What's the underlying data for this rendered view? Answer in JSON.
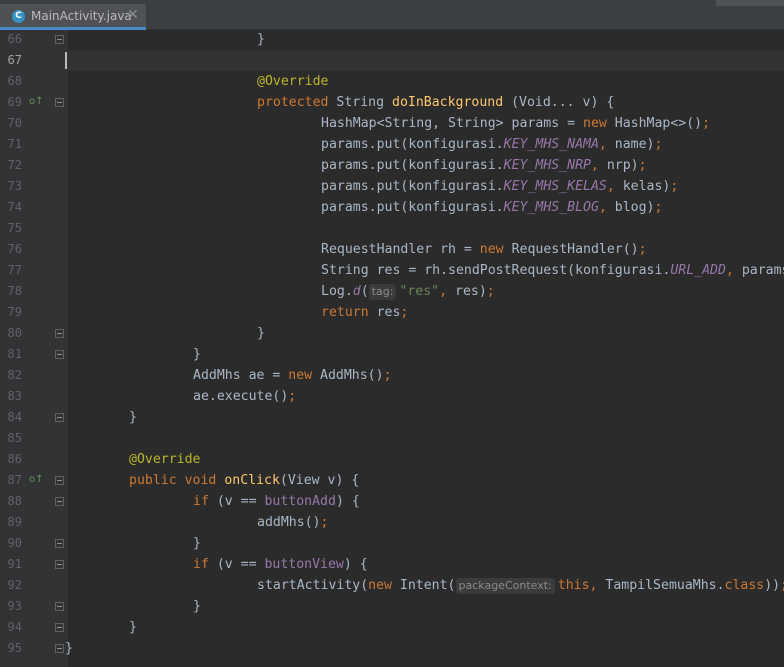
{
  "tab": {
    "title": "MainActivity.java",
    "icon_letter": "C",
    "icon": "class-icon",
    "close": "✕"
  },
  "lines": [
    {
      "n": "66",
      "indent": 24,
      "fold": true,
      "tokens": [
        [
          "}",
          ""
        ]
      ]
    },
    {
      "n": "67",
      "indent": 0,
      "current": true,
      "caret": true,
      "tokens": []
    },
    {
      "n": "68",
      "indent": 24,
      "tokens": [
        [
          "@Override",
          "ann"
        ]
      ]
    },
    {
      "n": "69",
      "indent": 24,
      "fold": true,
      "mark": "o↑",
      "tokens": [
        [
          "protected",
          "kw"
        ],
        [
          " String ",
          ""
        ],
        [
          "doInBackground",
          "fn"
        ],
        [
          " (Void... v) {",
          ""
        ]
      ]
    },
    {
      "n": "70",
      "indent": 32,
      "tokens": [
        [
          "HashMap<String, String> params = ",
          ""
        ],
        [
          "new",
          "kw"
        ],
        [
          " HashMap<>()",
          ""
        ],
        [
          ";",
          "kw"
        ]
      ]
    },
    {
      "n": "71",
      "indent": 32,
      "tokens": [
        [
          "params.put(konfigurasi.",
          ""
        ],
        [
          "KEY_MHS_NAMA",
          "it"
        ],
        [
          ", ",
          "kw"
        ],
        [
          "name)",
          ""
        ],
        [
          ";",
          "kw"
        ]
      ]
    },
    {
      "n": "72",
      "indent": 32,
      "tokens": [
        [
          "params.put(konfigurasi.",
          ""
        ],
        [
          "KEY_MHS_NRP",
          "it"
        ],
        [
          ", ",
          "kw"
        ],
        [
          "nrp)",
          ""
        ],
        [
          ";",
          "kw"
        ]
      ]
    },
    {
      "n": "73",
      "indent": 32,
      "tokens": [
        [
          "params.put(konfigurasi.",
          ""
        ],
        [
          "KEY_MHS_KELAS",
          "it"
        ],
        [
          ", ",
          "kw"
        ],
        [
          "kelas)",
          ""
        ],
        [
          ";",
          "kw"
        ]
      ]
    },
    {
      "n": "74",
      "indent": 32,
      "tokens": [
        [
          "params.put(konfigurasi.",
          ""
        ],
        [
          "KEY_MHS_BLOG",
          "it"
        ],
        [
          ", ",
          "kw"
        ],
        [
          "blog)",
          ""
        ],
        [
          ";",
          "kw"
        ]
      ]
    },
    {
      "n": "75",
      "indent": 0,
      "tokens": []
    },
    {
      "n": "76",
      "indent": 32,
      "tokens": [
        [
          "RequestHandler rh = ",
          ""
        ],
        [
          "new",
          "kw"
        ],
        [
          " RequestHandler()",
          ""
        ],
        [
          ";",
          "kw"
        ]
      ]
    },
    {
      "n": "77",
      "indent": 32,
      "tokens": [
        [
          "String res = rh.sendPostRequest(konfigurasi.",
          ""
        ],
        [
          "URL_ADD",
          "it"
        ],
        [
          ", ",
          "kw"
        ],
        [
          "params)",
          ""
        ],
        [
          ";",
          "kw"
        ]
      ]
    },
    {
      "n": "78",
      "indent": 32,
      "tokens": [
        [
          "Log.",
          ""
        ],
        [
          "d",
          "it"
        ],
        [
          "(",
          ""
        ],
        [
          "tag:",
          "hint"
        ],
        [
          "\"res\"",
          "str"
        ],
        [
          ", ",
          "kw"
        ],
        [
          "res)",
          ""
        ],
        [
          ";",
          "kw"
        ]
      ]
    },
    {
      "n": "79",
      "indent": 32,
      "tokens": [
        [
          "return",
          "kw"
        ],
        [
          " res",
          ""
        ],
        [
          ";",
          "kw"
        ]
      ]
    },
    {
      "n": "80",
      "indent": 24,
      "fold": true,
      "tokens": [
        [
          "}",
          ""
        ]
      ]
    },
    {
      "n": "81",
      "indent": 16,
      "fold": true,
      "tokens": [
        [
          "}",
          ""
        ]
      ]
    },
    {
      "n": "82",
      "indent": 16,
      "tokens": [
        [
          "AddMhs ae = ",
          ""
        ],
        [
          "new",
          "kw"
        ],
        [
          " AddMhs()",
          ""
        ],
        [
          ";",
          "kw"
        ]
      ]
    },
    {
      "n": "83",
      "indent": 16,
      "tokens": [
        [
          "ae.execute()",
          ""
        ],
        [
          ";",
          "kw"
        ]
      ]
    },
    {
      "n": "84",
      "indent": 8,
      "fold": true,
      "tokens": [
        [
          "}",
          ""
        ]
      ]
    },
    {
      "n": "85",
      "indent": 0,
      "tokens": []
    },
    {
      "n": "86",
      "indent": 8,
      "tokens": [
        [
          "@Override",
          "ann"
        ]
      ]
    },
    {
      "n": "87",
      "indent": 8,
      "fold": true,
      "mark": "o↑",
      "tokens": [
        [
          "public",
          "kw"
        ],
        [
          " ",
          ""
        ],
        [
          "void",
          "kw"
        ],
        [
          " ",
          ""
        ],
        [
          "onClick",
          "fn"
        ],
        [
          "(View v) {",
          ""
        ]
      ]
    },
    {
      "n": "88",
      "indent": 16,
      "fold": true,
      "tokens": [
        [
          "if",
          "kw"
        ],
        [
          " (v == ",
          ""
        ],
        [
          "buttonAdd",
          "fld"
        ],
        [
          ") {",
          ""
        ]
      ]
    },
    {
      "n": "89",
      "indent": 24,
      "tokens": [
        [
          "addMhs()",
          ""
        ],
        [
          ";",
          "kw"
        ]
      ]
    },
    {
      "n": "90",
      "indent": 16,
      "fold": true,
      "tokens": [
        [
          "}",
          ""
        ]
      ]
    },
    {
      "n": "91",
      "indent": 16,
      "fold": true,
      "tokens": [
        [
          "if",
          "kw"
        ],
        [
          " (v == ",
          ""
        ],
        [
          "buttonView",
          "fld"
        ],
        [
          ") {",
          ""
        ]
      ]
    },
    {
      "n": "92",
      "indent": 24,
      "tokens": [
        [
          "startActivity(",
          ""
        ],
        [
          "new",
          "kw"
        ],
        [
          " Intent(",
          ""
        ],
        [
          "packageContext:",
          "hint"
        ],
        [
          "this",
          "kw"
        ],
        [
          ", ",
          "kw"
        ],
        [
          "TampilSemuaMhs.",
          ""
        ],
        [
          "class",
          "kw"
        ],
        [
          "))",
          ""
        ],
        [
          ";",
          "kw"
        ]
      ]
    },
    {
      "n": "93",
      "indent": 16,
      "fold": true,
      "tokens": [
        [
          "}",
          ""
        ]
      ]
    },
    {
      "n": "94",
      "indent": 8,
      "fold": true,
      "tokens": [
        [
          "}",
          ""
        ]
      ]
    },
    {
      "n": "95",
      "indent": 0,
      "fold": true,
      "tokens": [
        [
          "}",
          ""
        ]
      ]
    }
  ]
}
